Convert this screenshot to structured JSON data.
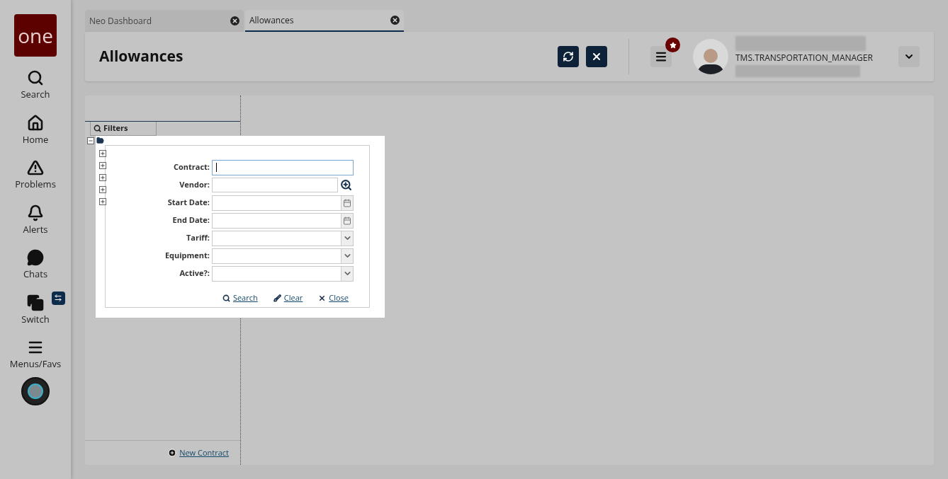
{
  "sidebar": {
    "logo": "one",
    "items": [
      {
        "kind": "search",
        "label": "Search"
      },
      {
        "kind": "home",
        "label": "Home"
      },
      {
        "kind": "problems",
        "label": "Problems"
      },
      {
        "kind": "alerts",
        "label": "Alerts"
      },
      {
        "kind": "chats",
        "label": "Chats"
      },
      {
        "kind": "switch",
        "label": "Switch"
      },
      {
        "kind": "menus",
        "label": "Menus/Favs"
      }
    ]
  },
  "tabs": [
    {
      "label": "Neo Dashboard",
      "selected": false
    },
    {
      "label": "Allowances",
      "selected": true
    }
  ],
  "header": {
    "title": "Allowances",
    "user_role": "TMS.TRANSPORTATION_MANAGER"
  },
  "filters_tab": {
    "label": "Filters"
  },
  "tree": {
    "expanded": true,
    "children": [
      {
        "expanded": false
      },
      {
        "expanded": false
      },
      {
        "expanded": false
      },
      {
        "expanded": false
      },
      {
        "expanded": false
      }
    ]
  },
  "new_contract_link": "New Contract",
  "filter_popup": {
    "fields": [
      {
        "label": "Contract:",
        "kind": "text",
        "focused": true
      },
      {
        "label": "Vendor:",
        "kind": "lookup",
        "focused": false
      },
      {
        "label": "Start Date:",
        "kind": "date",
        "focused": false
      },
      {
        "label": "End Date:",
        "kind": "date",
        "focused": false
      },
      {
        "label": "Tariff:",
        "kind": "select",
        "focused": false
      },
      {
        "label": "Equipment:",
        "kind": "select",
        "focused": false
      },
      {
        "label": "Active?:",
        "kind": "select",
        "focused": false
      }
    ],
    "actions": [
      {
        "kind": "search",
        "label": "Search"
      },
      {
        "kind": "clear",
        "label": "Clear"
      },
      {
        "kind": "close",
        "label": "Close"
      }
    ]
  }
}
